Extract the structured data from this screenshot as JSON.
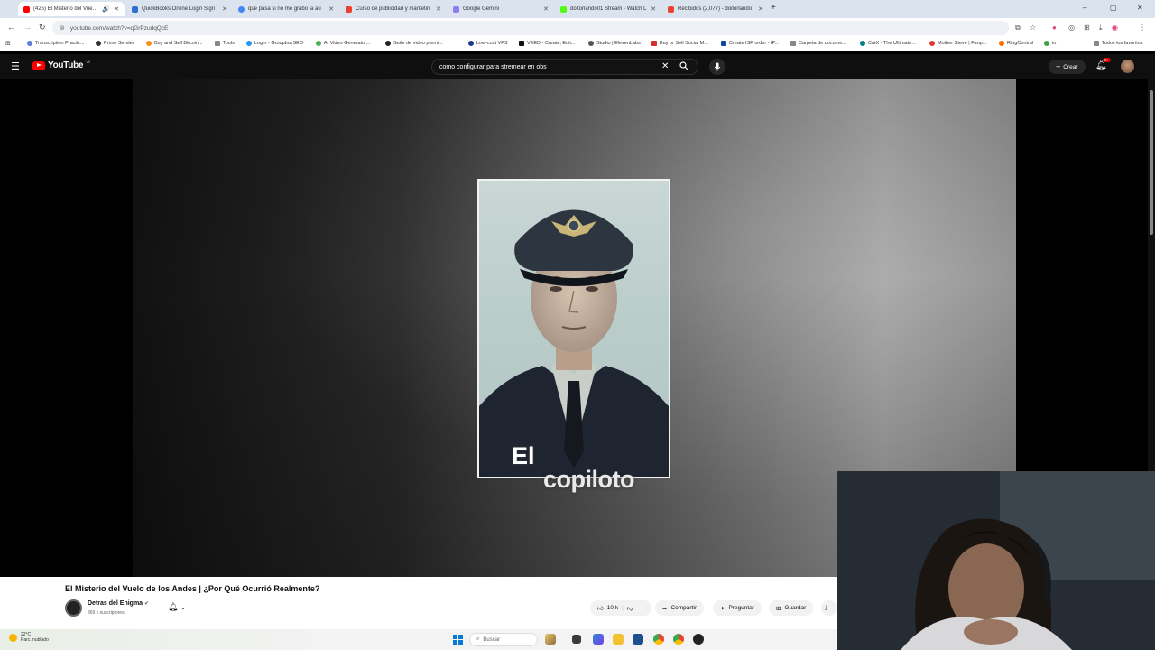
{
  "tabs": [
    {
      "title": "(425) El Misterio del Vuelo de",
      "color": "#ff0000",
      "active": true
    },
    {
      "title": "QuickBooks Online Login Sign",
      "color": "#2ca01c"
    },
    {
      "title": "que pasa si no me grabo la au",
      "color": "#4285f4"
    },
    {
      "title": "Curso de publicidad y marketin",
      "color": "#e94235"
    },
    {
      "title": "Google Gemini",
      "color": "#8e7cf3"
    },
    {
      "title": "doitorlando01 Stream - Watch L",
      "color": "#53fc18"
    },
    {
      "title": "Recibidos (2,077) - doitorlando",
      "color": "#ea4335"
    }
  ],
  "browser": {
    "new_tab": "+",
    "url": "youtube.com/watch?v=qGrPzudqQcE",
    "win_min": "–",
    "win_max": "▢",
    "win_close": "✕"
  },
  "bookmarks": [
    {
      "label": "Transcription Practic...",
      "color": "#5b7fd6"
    },
    {
      "label": "Prime Sender",
      "color": "#333"
    },
    {
      "label": "Buy and Sell Bitcoin...",
      "color": "#f7931a"
    },
    {
      "label": "Tools",
      "color": "#888"
    },
    {
      "label": "Login - GroupbuySEO",
      "color": "#2196f3"
    },
    {
      "label": "AI Video Generator...",
      "color": "#4caf50"
    },
    {
      "label": "Suite de video premi...",
      "color": "#222"
    },
    {
      "label": "Low-cost VPS",
      "color": "#1e3a8a"
    },
    {
      "label": "VEED - Create, Edit...",
      "color": "#111"
    },
    {
      "label": "Studio | ElevenLabs",
      "color": "#555"
    },
    {
      "label": "Buy or Sell Social M...",
      "color": "#d32f2f"
    },
    {
      "label": "Create ISP order - IP...",
      "color": "#0d47a1"
    },
    {
      "label": "Carpeta de docume...",
      "color": "#888"
    },
    {
      "label": "CatX - The Ultimate...",
      "color": "#00838f"
    },
    {
      "label": "Mother Steve | Fanp...",
      "color": "#e53935"
    },
    {
      "label": "RingCentral",
      "color": "#ff6f00"
    },
    {
      "label": "io",
      "color": "#43a047"
    },
    {
      "label": "Todos los favoritos",
      "color": "#888"
    }
  ],
  "youtube": {
    "logo": "YouTube",
    "country": "VE",
    "search_query": "como configurar para stremear en obs",
    "create_label": "Crear",
    "notif_badge": "9+"
  },
  "video": {
    "caption_line1": "El",
    "caption_line2": "copiloto",
    "title": "El Misterio del Vuelo de los Andes | ¿Por Qué Ocurrió Realmente?",
    "channel": "Detras del Enigma",
    "subscribers": "369 k suscriptores",
    "likes": "10 k",
    "share_label": "Compartir",
    "ask_label": "Preguntar",
    "save_label": "Guardar"
  },
  "taskbar": {
    "temp": "22°C",
    "weather": "Parc. nublado",
    "search_placeholder": "Buscar"
  },
  "colors": {
    "yt_red": "#ff0000",
    "yt_bg": "#0f0f0f",
    "windows_blue": "#0a78d7"
  },
  "icons": [
    "menu-icon",
    "search-icon",
    "clear-icon",
    "mic-icon",
    "plus-icon",
    "bell-icon",
    "like-icon",
    "dislike-icon",
    "share-icon",
    "sparkle-icon",
    "save-icon",
    "download-icon",
    "windows-icon"
  ]
}
